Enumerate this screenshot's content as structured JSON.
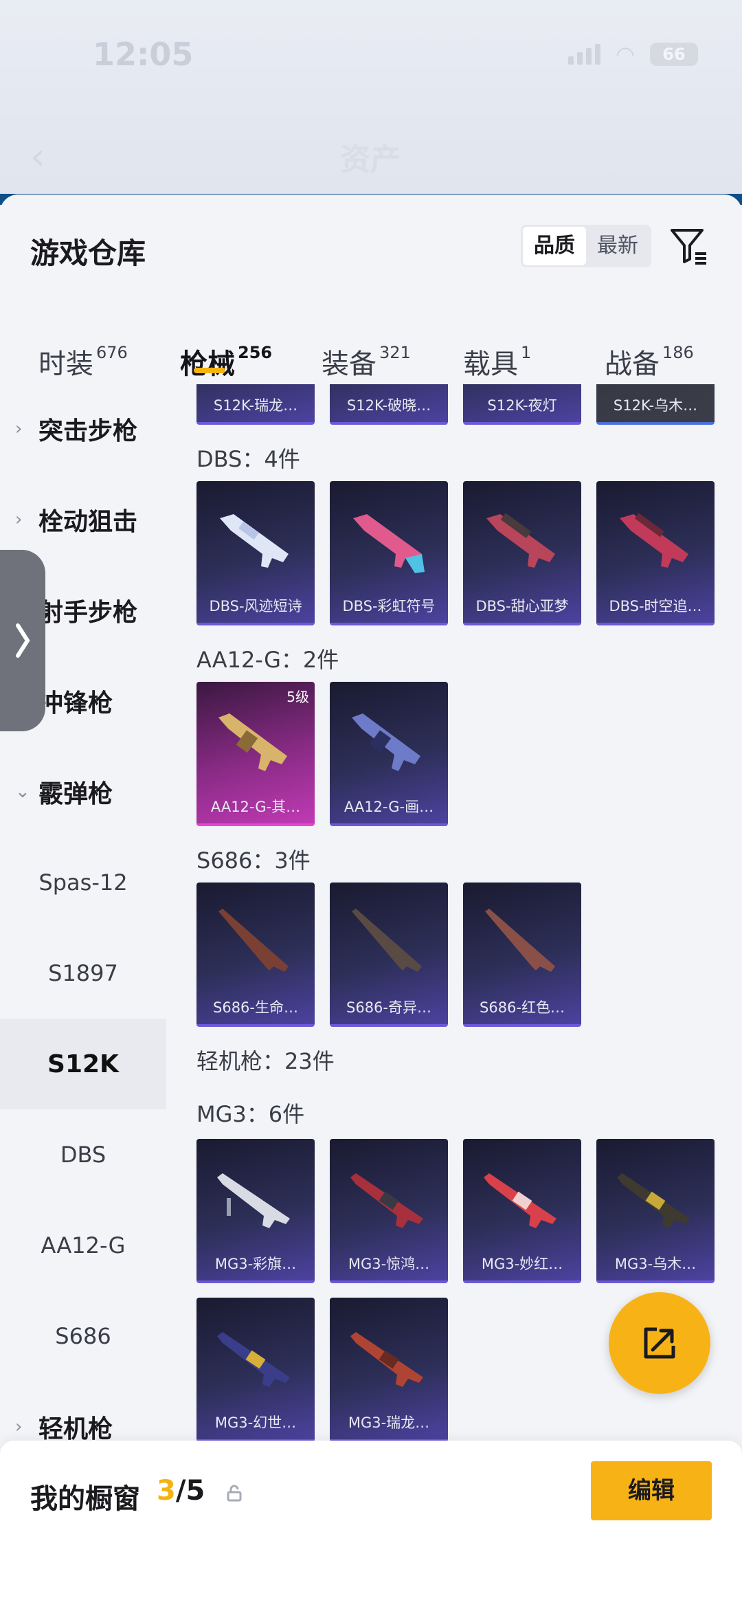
{
  "status_bar": {
    "time": "12:05",
    "battery": "66"
  },
  "nav": {
    "title": "资产"
  },
  "sheet": {
    "title": "游戏仓库",
    "sort_options": [
      "品质",
      "最新"
    ],
    "active_sort": "品质"
  },
  "tabs": [
    {
      "label": "时装",
      "count": "676"
    },
    {
      "label": "枪械",
      "count": "256"
    },
    {
      "label": "装备",
      "count": "321"
    },
    {
      "label": "载具",
      "count": "1"
    },
    {
      "label": "战备",
      "count": "186"
    }
  ],
  "sidebar": {
    "items": [
      {
        "label": "突击步枪",
        "type": "category",
        "chevron": "›"
      },
      {
        "label": "栓动狙击",
        "type": "category",
        "chevron": "›"
      },
      {
        "label": "射手步枪",
        "type": "category",
        "chevron": "›"
      },
      {
        "label": "冲锋枪",
        "type": "category",
        "chevron": "›"
      },
      {
        "label": "霰弹枪",
        "type": "category",
        "chevron": "⌄"
      },
      {
        "label": "Spas-12",
        "type": "sub"
      },
      {
        "label": "S1897",
        "type": "sub"
      },
      {
        "label": "S12K",
        "type": "sub",
        "selected": true
      },
      {
        "label": "DBS",
        "type": "sub"
      },
      {
        "label": "AA12-G",
        "type": "sub"
      },
      {
        "label": "S686",
        "type": "sub"
      },
      {
        "label": "轻机枪",
        "type": "category",
        "chevron": "›"
      }
    ]
  },
  "content": {
    "top_row": [
      "S12K-瑞龙…",
      "S12K-破晓…",
      "S12K-夜灯",
      "S12K-乌木…"
    ],
    "groups": [
      {
        "label": "DBS：4件",
        "items": [
          "DBS-风迹短诗",
          "DBS-彩虹符号",
          "DBS-甜心亚梦",
          "DBS-时空追…"
        ]
      },
      {
        "label": "AA12-G：2件",
        "items": [
          "AA12-G-其…",
          "AA12-G-画…"
        ],
        "level_badge": "5级"
      },
      {
        "label": "S686：3件",
        "items": [
          "S686-生命…",
          "S686-奇异…",
          "S686-红色…"
        ]
      },
      {
        "label": "轻机枪：23件",
        "items": []
      },
      {
        "label": "MG3：6件",
        "items": [
          "MG3-彩旗…",
          "MG3-惊鸿…",
          "MG3-妙红…",
          "MG3-乌木…",
          "MG3-幻世…",
          "MG3-瑞龙…"
        ]
      }
    ]
  },
  "bottom_bar": {
    "label": "我的橱窗",
    "current": "3",
    "total": "/5",
    "edit_label": "编辑"
  },
  "colors": {
    "accent": "#f7b316",
    "card_purple": "#4d42a0",
    "card_gold": "#c03ab4"
  }
}
